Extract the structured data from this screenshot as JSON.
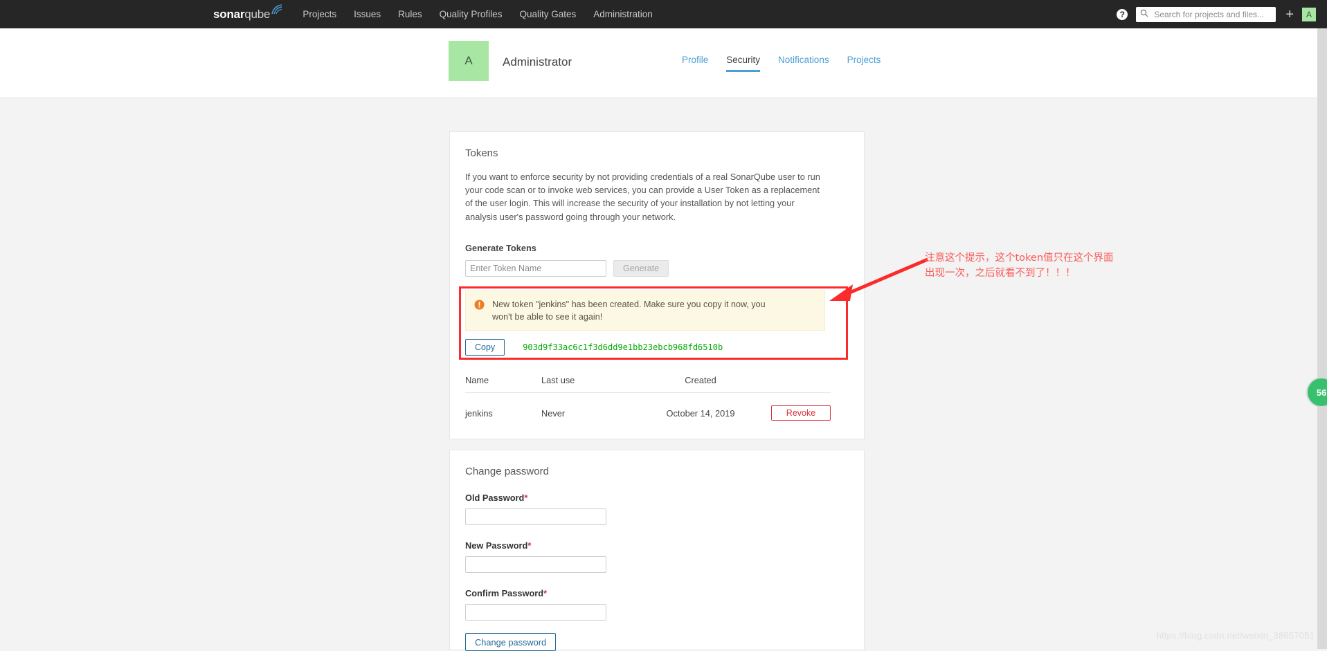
{
  "navbar": {
    "logo_part1": "sonar",
    "logo_part2": "qube",
    "items": [
      {
        "label": "Projects"
      },
      {
        "label": "Issues"
      },
      {
        "label": "Rules"
      },
      {
        "label": "Quality Profiles"
      },
      {
        "label": "Quality Gates"
      },
      {
        "label": "Administration"
      }
    ],
    "help_icon": "question-mark-icon",
    "search": {
      "icon": "search-icon",
      "placeholder": "Search for projects and files...",
      "value": ""
    },
    "plus_label": "+",
    "avatar_initial": "A"
  },
  "profile": {
    "avatar_initial": "A",
    "user_name": "Administrator",
    "tabs": [
      {
        "label": "Profile",
        "active": false
      },
      {
        "label": "Security",
        "active": true
      },
      {
        "label": "Notifications",
        "active": false
      },
      {
        "label": "Projects",
        "active": false
      }
    ]
  },
  "tokens_card": {
    "title": "Tokens",
    "description": "If you want to enforce security by not providing credentials of a real SonarQube user to run your code scan or to invoke web services, you can provide a User Token as a replacement of the user login. This will increase the security of your installation by not letting your analysis user's password going through your network.",
    "generate_label": "Generate Tokens",
    "token_name_placeholder": "Enter Token Name",
    "token_name_value": "",
    "generate_button": "Generate",
    "alert": {
      "icon": "warning-exclamation-icon",
      "text": "New token \"jenkins\" has been created. Make sure you copy it now, you won't be able to see it again!"
    },
    "copy_button": "Copy",
    "token_value": "903d9f33ac6c1f3d6dd9e1bb23ebcb968fd6510b",
    "table": {
      "headers": [
        "Name",
        "Last use",
        "Created",
        ""
      ],
      "rows": [
        {
          "name": "jenkins",
          "last_use": "Never",
          "created": "October 14, 2019",
          "action": "Revoke"
        }
      ]
    }
  },
  "password_card": {
    "title": "Change password",
    "old_password_label": "Old Password",
    "new_password_label": "New Password",
    "confirm_password_label": "Confirm Password",
    "required_mark": "*",
    "old_password_value": "",
    "new_password_value": "",
    "confirm_password_value": "",
    "submit_button": "Change password"
  },
  "annotation": {
    "text_line1": "注意这个提示，这个token值只在这个界面",
    "text_line2": "出现一次，之后就看不到了！！！",
    "box_color": "#fc2b2b",
    "text_color": "#fc5a5a"
  },
  "misc": {
    "edge_badge": "56",
    "watermark": "https://blog.csdn.net/weixin_38657051"
  }
}
